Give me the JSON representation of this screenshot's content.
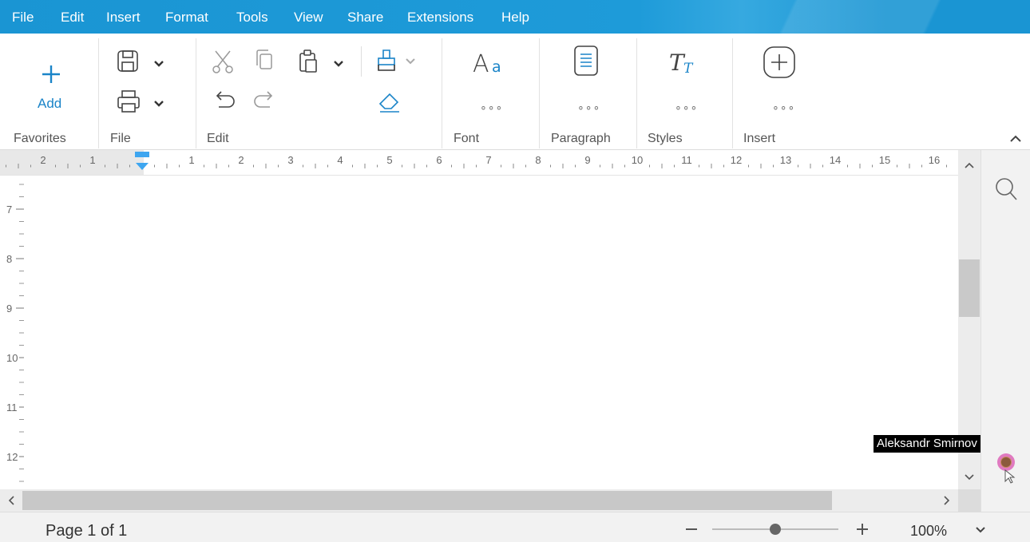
{
  "menu": [
    "File",
    "Edit",
    "Insert",
    "Format",
    "Tools",
    "View",
    "Share",
    "Extensions",
    "Help"
  ],
  "ribbon": {
    "add_label": "Add",
    "groups": {
      "favorites": "Favorites",
      "file": "File",
      "edit": "Edit",
      "font": "Font",
      "paragraph": "Paragraph",
      "styles": "Styles",
      "insert": "Insert"
    },
    "more": "∘∘∘",
    "icons": [
      "plus-icon",
      "save-icon",
      "print-icon",
      "cut-icon",
      "copy-icon",
      "paste-icon",
      "format-painter-icon",
      "undo-icon",
      "redo-icon",
      "eraser-icon",
      "font-icon",
      "paragraph-icon",
      "styles-icon",
      "insert-plus-icon"
    ]
  },
  "ruler": {
    "h_labels": [
      "2",
      "1",
      "1",
      "2",
      "3",
      "4",
      "5",
      "6",
      "7",
      "8",
      "9",
      "10",
      "11",
      "12",
      "13",
      "14",
      "15",
      "16"
    ],
    "v_labels": [
      "7",
      "8",
      "9",
      "10",
      "11",
      "12"
    ]
  },
  "collaborator": {
    "name": "Aleksandr Smirnov"
  },
  "status": {
    "page": "Page 1 of 1",
    "zoom": "100%",
    "zoom_level": 0.5
  },
  "colors": {
    "accent": "#1a95d3",
    "ruler_marker": "#3ea6f0"
  }
}
